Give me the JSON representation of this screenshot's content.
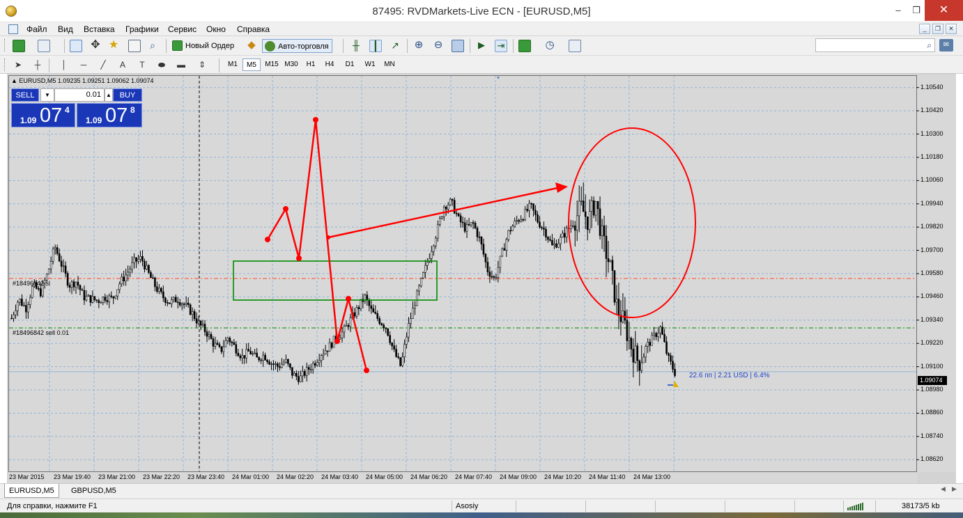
{
  "window": {
    "title": "87495: RVDMarkets-Live ECN - [EURUSD,M5]",
    "minimize_label": "–",
    "maximize_label": "❐",
    "close_label": "✕"
  },
  "menu": [
    "Файл",
    "Вид",
    "Вставка",
    "Графики",
    "Сервис",
    "Окно",
    "Справка"
  ],
  "toolbar": {
    "new_order_label": "Новый Ордер",
    "auto_trading_label": "Авто-торговля",
    "search_placeholder": ""
  },
  "timeframes": [
    "M1",
    "M5",
    "M15",
    "M30",
    "H1",
    "H4",
    "D1",
    "W1",
    "MN"
  ],
  "active_timeframe": "M5",
  "chart": {
    "symbol_info": "EURUSD,M5  1.09235 1.09251 1.09062 1.09074",
    "trade_panel": {
      "sell_label": "SELL",
      "buy_label": "BUY",
      "lot": "0.01",
      "sell_price_small": "1.09",
      "sell_price_big": "07",
      "sell_price_sup": "4",
      "buy_price_small": "1.09",
      "buy_price_big": "07",
      "buy_price_sup": "8"
    },
    "order_line_1": "#18496842 sl",
    "order_line_2": "#18496842 sell 0.01",
    "profit_label": "22.6 пп | 2.21 USD | 6.4%",
    "current_price": "1.09074",
    "colors": {
      "candle": "#000000",
      "grid": "#8fb4d8",
      "stop_loss_line": "#ff4a2a",
      "open_order_line": "#008a00",
      "annotation": "#ff0000",
      "box": "#008a00"
    }
  },
  "chart_data": {
    "type": "candlestick",
    "symbol": "EURUSD",
    "timeframe": "M5",
    "ylim": [
      1.0856,
      1.106
    ],
    "price_ticks": [
      "1.10540",
      "1.10420",
      "1.10300",
      "1.10180",
      "1.10060",
      "1.09940",
      "1.09820",
      "1.09700",
      "1.09580",
      "1.09460",
      "1.09340",
      "1.09220",
      "1.09100",
      "1.08980",
      "1.08860",
      "1.08740",
      "1.08620"
    ],
    "time_ticks": [
      "23 Mar 2015",
      "23 Mar 19:40",
      "23 Mar 21:00",
      "23 Mar 22:20",
      "23 Mar 23:40",
      "24 Mar 01:00",
      "24 Mar 02:20",
      "24 Mar 03:40",
      "24 Mar 05:00",
      "24 Mar 06:20",
      "24 Mar 07:40",
      "24 Mar 09:00",
      "24 Mar 10:20",
      "24 Mar 11:40",
      "24 Mar 13:00"
    ],
    "close_path": [
      1.0935,
      1.0945,
      1.094,
      1.0952,
      1.0948,
      1.0958,
      1.0972,
      1.0962,
      1.0952,
      1.0954,
      1.0946,
      1.0945,
      1.0944,
      1.0946,
      1.0945,
      1.0953,
      1.0958,
      1.0964,
      1.0966,
      1.0958,
      1.0951,
      1.0946,
      1.0943,
      1.0945,
      1.0942,
      1.0938,
      1.0932,
      1.0928,
      1.0922,
      1.0918,
      1.0925,
      1.092,
      1.0915,
      1.0918,
      1.0914,
      1.0916,
      1.0912,
      1.091,
      1.0913,
      1.0906,
      1.0904,
      1.0908,
      1.0912,
      1.0917,
      1.092,
      1.0925,
      1.0928,
      1.0934,
      1.094,
      1.0946,
      1.0938,
      1.0934,
      1.093,
      1.0918,
      1.091,
      1.093,
      1.0944,
      1.0956,
      1.0968,
      1.098,
      1.0993,
      1.0995,
      1.0986,
      1.0981,
      1.0984,
      1.0975,
      1.096,
      1.0955,
      1.0968,
      1.098,
      1.0985,
      1.0988,
      1.0993,
      1.0985,
      1.098,
      1.0972,
      1.0975,
      1.098,
      1.0985,
      1.0992,
      1.0985,
      1.0996,
      1.0975,
      1.0962,
      1.094,
      1.0932,
      1.092,
      1.0912,
      1.092,
      1.0925,
      1.093,
      1.0915,
      1.0907
    ],
    "x_scale": "time",
    "grid": true
  },
  "tabs": [
    "EURUSD,M5",
    "GBPUSD,M5"
  ],
  "status": {
    "help": "Для справки, нажмите F1",
    "profile": "Asosiy",
    "traffic": "38173/5 kb"
  }
}
